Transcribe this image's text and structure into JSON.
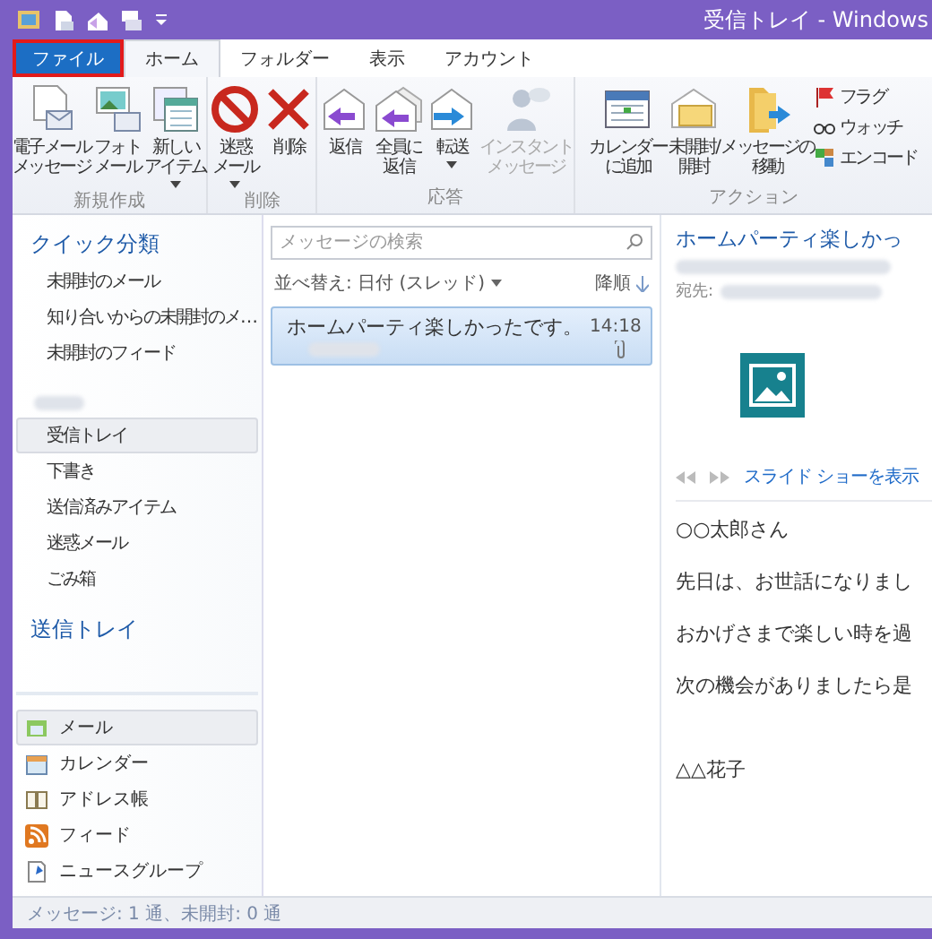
{
  "window": {
    "title": "受信トレイ - Windows"
  },
  "ribbon_tabs": [
    {
      "label": "ファイル",
      "kind": "file",
      "selected": false,
      "highlighted": true
    },
    {
      "label": "ホーム",
      "kind": "tab",
      "selected": true,
      "highlighted": false
    },
    {
      "label": "フォルダー",
      "kind": "tab",
      "selected": false,
      "highlighted": false
    },
    {
      "label": "表示",
      "kind": "tab",
      "selected": false,
      "highlighted": false
    },
    {
      "label": "アカウント",
      "kind": "tab",
      "selected": false,
      "highlighted": false
    }
  ],
  "ribbon_groups": [
    {
      "label": "新規作成",
      "buttons": [
        {
          "lines": [
            "電子メール",
            "メッセージ"
          ],
          "dropdown": false,
          "disabled": false
        },
        {
          "lines": [
            "フォト",
            "メール"
          ],
          "dropdown": false,
          "disabled": false
        },
        {
          "lines": [
            "新しい",
            "アイテム"
          ],
          "dropdown": true,
          "disabled": false
        }
      ]
    },
    {
      "label": "削除",
      "buttons": [
        {
          "lines": [
            "迷惑",
            "メール"
          ],
          "dropdown": true,
          "disabled": false
        },
        {
          "lines": [
            "削除"
          ],
          "dropdown": false,
          "disabled": false
        }
      ]
    },
    {
      "label": "応答",
      "buttons": [
        {
          "lines": [
            "返信"
          ],
          "dropdown": false,
          "disabled": false
        },
        {
          "lines": [
            "全員に",
            "返信"
          ],
          "dropdown": false,
          "disabled": false
        },
        {
          "lines": [
            "転送"
          ],
          "dropdown": true,
          "disabled": false
        },
        {
          "lines": [
            "インスタント",
            "メッセージ"
          ],
          "dropdown": false,
          "disabled": true
        }
      ]
    },
    {
      "label": "アクション",
      "buttons": [
        {
          "lines": [
            "カレンダー",
            "に追加"
          ],
          "dropdown": false,
          "disabled": false
        },
        {
          "lines": [
            "未開封/",
            "開封"
          ],
          "dropdown": false,
          "disabled": false
        },
        {
          "lines": [
            "メッセージの",
            "移動"
          ],
          "dropdown": false,
          "disabled": false
        }
      ],
      "small_buttons": [
        "フラグ",
        "ウォッチ",
        "エンコード"
      ]
    }
  ],
  "nav": {
    "quick_header": "クイック分類",
    "quick_items": [
      "未開封のメール",
      "知り合いからの未開封のメ…",
      "未開封のフィード"
    ],
    "folders": [
      {
        "label": "受信トレイ",
        "selected": true
      },
      {
        "label": "下書き",
        "selected": false
      },
      {
        "label": "送信済みアイテム",
        "selected": false
      },
      {
        "label": "迷惑メール",
        "selected": false
      },
      {
        "label": "ごみ箱",
        "selected": false
      }
    ],
    "outbox_header": "送信トレイ",
    "modules": [
      {
        "label": "メール",
        "selected": true
      },
      {
        "label": "カレンダー",
        "selected": false
      },
      {
        "label": "アドレス帳",
        "selected": false
      },
      {
        "label": "フィード",
        "selected": false
      },
      {
        "label": "ニュースグループ",
        "selected": false
      }
    ]
  },
  "message_list": {
    "search": {
      "placeholder": "メッセージの検索"
    },
    "sort": "並べ替え: 日付 (スレッド)",
    "order": "降順",
    "messages": [
      {
        "subject": "ホームパーティ楽しかったです。",
        "time": "14:18",
        "selected": true,
        "attachment": true
      }
    ]
  },
  "reading_pane": {
    "subject": "ホームパーティ楽しかっ",
    "to_label": "宛先:",
    "slideshow_link": "スライド ショーを表示",
    "body": [
      "○○太郎さん",
      "先日は、お世話になりまし",
      "おかげさまで楽しい時を過",
      "次の機会がありましたら是",
      "△△花子"
    ]
  },
  "status_bar": "メッセージ: 1 通、未開封: 0 通"
}
